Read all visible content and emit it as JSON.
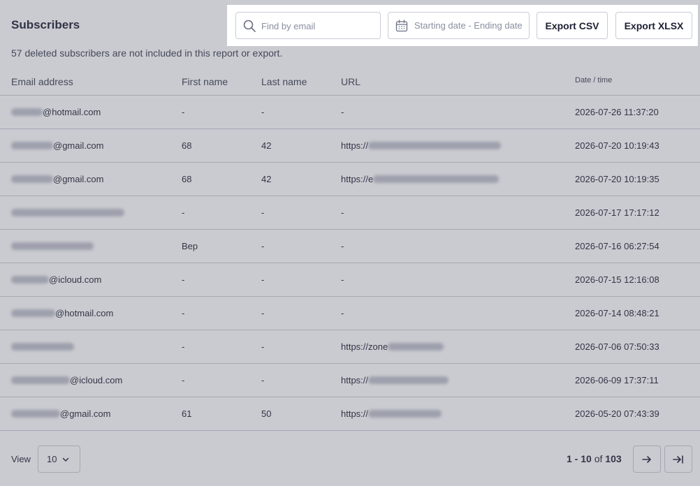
{
  "page": {
    "title": "Subscribers",
    "notice": "57 deleted subscribers are not included in this report or export."
  },
  "toolbar": {
    "search_placeholder": "Find by email",
    "date_placeholder": "Starting date - Ending date",
    "export_csv": "Export CSV",
    "export_xlsx": "Export XLSX"
  },
  "table": {
    "headers": {
      "email": "Email address",
      "first_name": "First name",
      "last_name": "Last name",
      "url": "URL",
      "datetime": "Date / time"
    },
    "rows": [
      {
        "email_visible": "@hotmail.com",
        "first": "-",
        "last": "-",
        "url_visible": "-",
        "datetime": "2026-07-26 11:37:20"
      },
      {
        "email_visible": "@gmail.com",
        "first": "68",
        "last": "42",
        "url_visible": "https://",
        "datetime": "2026-07-20 10:19:43"
      },
      {
        "email_visible": "@gmail.com",
        "first": "68",
        "last": "42",
        "url_visible": "https://e",
        "datetime": "2026-07-20 10:19:35"
      },
      {
        "email_visible": "",
        "first": "-",
        "last": "-",
        "url_visible": "-",
        "datetime": "2026-07-17 17:17:12"
      },
      {
        "email_visible": "",
        "first": "Bep",
        "last": "-",
        "url_visible": "-",
        "datetime": "2026-07-16 06:27:54"
      },
      {
        "email_visible": "@icloud.com",
        "first": "-",
        "last": "-",
        "url_visible": "-",
        "datetime": "2026-07-15 12:16:08"
      },
      {
        "email_visible": "@hotmail.com",
        "first": "-",
        "last": "-",
        "url_visible": "-",
        "datetime": "2026-07-14 08:48:21"
      },
      {
        "email_visible": "",
        "first": "-",
        "last": "-",
        "url_visible": "https://zone",
        "datetime": "2026-07-06 07:50:33"
      },
      {
        "email_visible": "@icloud.com",
        "first": "-",
        "last": "-",
        "url_visible": "https://",
        "datetime": "2026-06-09 17:37:11"
      },
      {
        "email_visible": "@gmail.com",
        "first": "61",
        "last": "50",
        "url_visible": "https://",
        "datetime": "2026-05-20 07:43:39"
      }
    ]
  },
  "footer": {
    "view_label": "View",
    "page_size": "10",
    "range": "1 - 10",
    "of_label": "of",
    "total": "103"
  },
  "icons": {
    "search": "search-icon",
    "calendar": "calendar-icon",
    "chevron": "chevron-down-icon",
    "next": "arrow-right-icon",
    "last": "arrow-right-to-line-icon"
  },
  "colors": {
    "text": "#1d2033",
    "border": "#c9ccd6",
    "overlay": "#5a5e6e"
  }
}
